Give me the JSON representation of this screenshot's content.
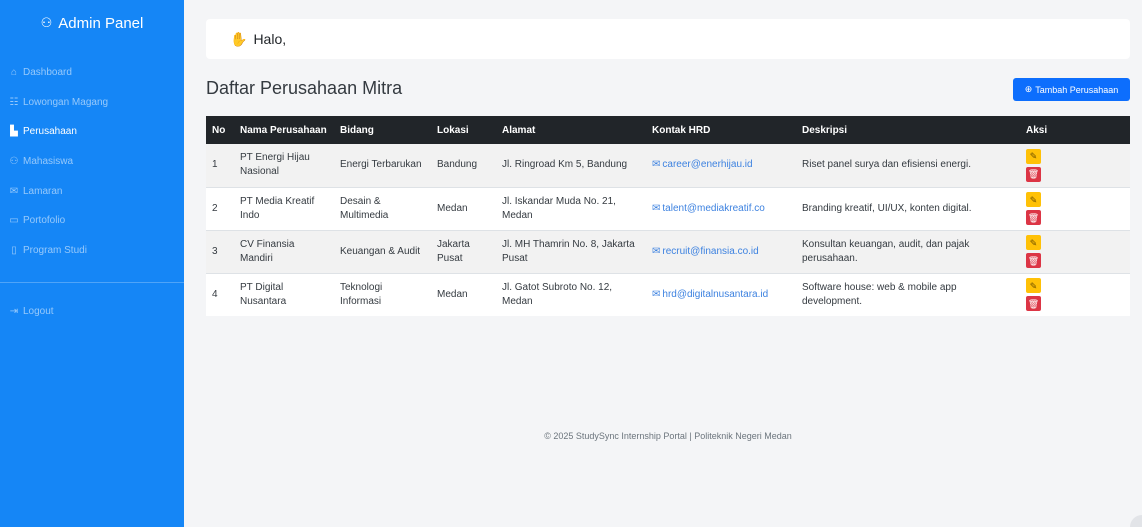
{
  "sidebar": {
    "brand_icon": "users-icon",
    "brand": "Admin Panel",
    "items": [
      {
        "icon": "home-icon",
        "glyph": "⌂",
        "label": "Dashboard",
        "active": false
      },
      {
        "icon": "list-icon",
        "glyph": "☷",
        "label": "Lowongan Magang",
        "active": false
      },
      {
        "icon": "chart-icon",
        "glyph": "▙",
        "label": "Perusahaan",
        "active": true
      },
      {
        "icon": "people-icon",
        "glyph": "⚇",
        "label": "Mahasiswa",
        "active": false
      },
      {
        "icon": "mail-icon",
        "glyph": "✉",
        "label": "Lamaran",
        "active": false
      },
      {
        "icon": "folder-icon",
        "glyph": "▭",
        "label": "Portofolio",
        "active": false
      },
      {
        "icon": "book-icon",
        "glyph": "▯",
        "label": "Program Studi",
        "active": false
      }
    ],
    "logout": {
      "icon": "logout-icon",
      "glyph": "⇥",
      "label": "Logout"
    }
  },
  "topbar": {
    "greeting": "Halo,"
  },
  "page": {
    "title": "Daftar Perusahaan Mitra",
    "add_button": "Tambah Perusahaan"
  },
  "table": {
    "headers": [
      "No",
      "Nama Perusahaan",
      "Bidang",
      "Lokasi",
      "Alamat",
      "Kontak HRD",
      "Deskripsi",
      "Aksi"
    ],
    "rows": [
      {
        "no": "1",
        "nama": "PT Energi Hijau Nasional",
        "bidang": "Energi Terbarukan",
        "lokasi": "Bandung",
        "alamat": "Jl. Ringroad Km 5, Bandung",
        "kontak": "career@enerhijau.id",
        "deskripsi": "Riset panel surya dan efisiensi energi."
      },
      {
        "no": "2",
        "nama": "PT Media Kreatif Indo",
        "bidang": "Desain & Multimedia",
        "lokasi": "Medan",
        "alamat": "Jl. Iskandar Muda No. 21, Medan",
        "kontak": "talent@mediakreatif.co",
        "deskripsi": "Branding kreatif, UI/UX, konten digital."
      },
      {
        "no": "3",
        "nama": "CV Finansia Mandiri",
        "bidang": "Keuangan & Audit",
        "lokasi": "Jakarta Pusat",
        "alamat": "Jl. MH Thamrin No. 8, Jakarta Pusat",
        "kontak": "recruit@finansia.co.id",
        "deskripsi": "Konsultan keuangan, audit, dan pajak perusahaan."
      },
      {
        "no": "4",
        "nama": "PT Digital Nusantara",
        "bidang": "Teknologi Informasi",
        "lokasi": "Medan",
        "alamat": "Jl. Gatot Subroto No. 12, Medan",
        "kontak": "hrd@digitalnusantara.id",
        "deskripsi": "Software house: web & mobile app development."
      }
    ]
  },
  "footer": {
    "text": "© 2025 StudySync Internship Portal | Politeknik Negeri Medan"
  },
  "colors": {
    "sidebar": "#1586f6",
    "primary": "#0d6efd",
    "warning": "#ffc107",
    "danger": "#dc3545",
    "table_header": "#212529"
  }
}
